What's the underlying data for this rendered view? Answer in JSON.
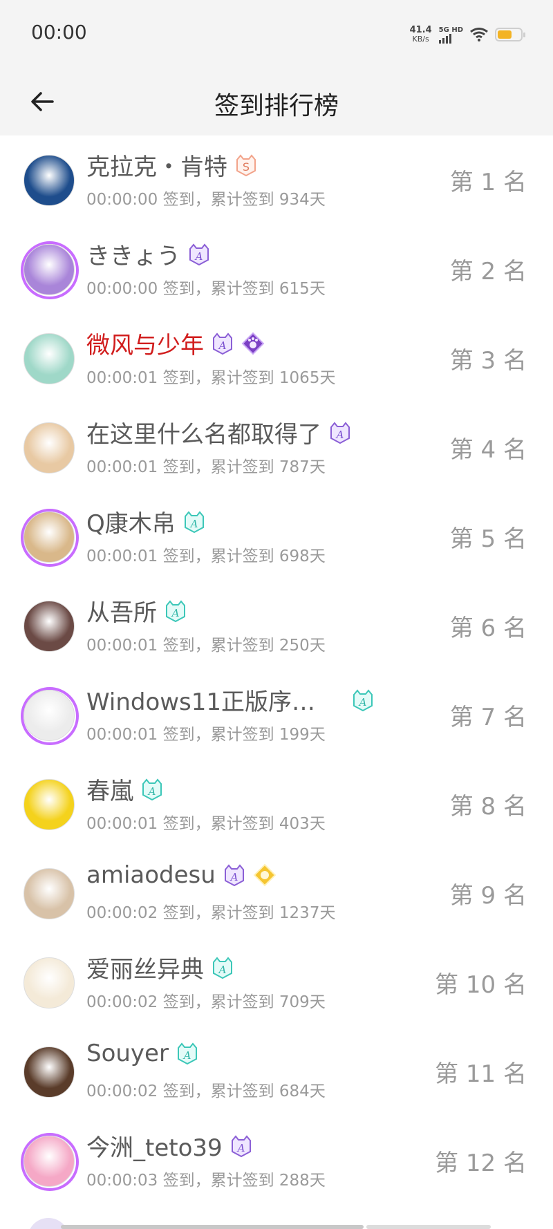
{
  "status_bar": {
    "time": "00:00",
    "net_speed": "41.4",
    "net_unit": "KB/s",
    "signal_label": "5G HD",
    "battery_level": 0.62,
    "battery_color": "#f3b323"
  },
  "header": {
    "title": "签到排行榜",
    "back_icon": "arrow-left-icon"
  },
  "rows": [
    {
      "name": "克拉克・肯特",
      "meta": "00:00:00 签到，累计签到 934天",
      "rank": "第 1 名",
      "badges": [
        "s-badge"
      ],
      "avatar_color": "#1e4d8c",
      "frame": false,
      "red": false
    },
    {
      "name": "ききょう",
      "meta": "00:00:00 签到，累计签到 615天",
      "rank": "第 2 名",
      "badges": [
        "purple-a"
      ],
      "avatar_color": "#a985d9",
      "frame": true,
      "red": false
    },
    {
      "name": "微风与少年",
      "meta": "00:00:01 签到，累计签到 1065天",
      "rank": "第 3 名",
      "badges": [
        "purple-a",
        "paw-diamond"
      ],
      "avatar_color": "#9fd8c8",
      "frame": false,
      "red": true
    },
    {
      "name": "在这里什么名都取得了",
      "meta": "00:00:01 签到，累计签到 787天",
      "rank": "第 4 名",
      "badges": [
        "purple-a"
      ],
      "avatar_color": "#e8c9a3",
      "frame": false,
      "red": false
    },
    {
      "name": "Q康木帛",
      "meta": "00:00:01 签到，累计签到 698天",
      "rank": "第 5 名",
      "badges": [
        "teal-a"
      ],
      "avatar_color": "#d9b88a",
      "frame": true,
      "red": false
    },
    {
      "name": "从吾所",
      "meta": "00:00:01 签到，累计签到 250天",
      "rank": "第 6 名",
      "badges": [
        "teal-a"
      ],
      "avatar_color": "#6b4a45",
      "frame": false,
      "red": false
    },
    {
      "name": "Windows11正版序…",
      "meta": "00:00:01 签到，累计签到 199天",
      "rank": "第 7 名",
      "badges": [
        "teal-a"
      ],
      "avatar_color": "#ececec",
      "frame": true,
      "red": false
    },
    {
      "name": "春嵐",
      "meta": "00:00:01 签到，累计签到 403天",
      "rank": "第 8 名",
      "badges": [
        "teal-a"
      ],
      "avatar_color": "#f4d21c",
      "frame": false,
      "red": false
    },
    {
      "name": "amiaodesu",
      "meta": "00:00:02 签到，累计签到 1237天",
      "rank": "第 9 名",
      "badges": [
        "purple-a",
        "gold-diamond"
      ],
      "avatar_color": "#d8c2a8",
      "frame": false,
      "red": false
    },
    {
      "name": "爱丽丝异典",
      "meta": "00:00:02 签到，累计签到 709天",
      "rank": "第 10 名",
      "badges": [
        "teal-a"
      ],
      "avatar_color": "#f4ead8",
      "frame": false,
      "red": false
    },
    {
      "name": "Souyer",
      "meta": "00:00:02 签到，累计签到 684天",
      "rank": "第 11 名",
      "badges": [
        "teal-a"
      ],
      "avatar_color": "#5a3c2a",
      "frame": false,
      "red": false
    },
    {
      "name": "今洲_teto39",
      "meta": "00:00:03 签到，累计签到 288天",
      "rank": "第 12 名",
      "badges": [
        "purple-a"
      ],
      "avatar_color": "#f5a8c6",
      "frame": true,
      "red": false
    }
  ]
}
